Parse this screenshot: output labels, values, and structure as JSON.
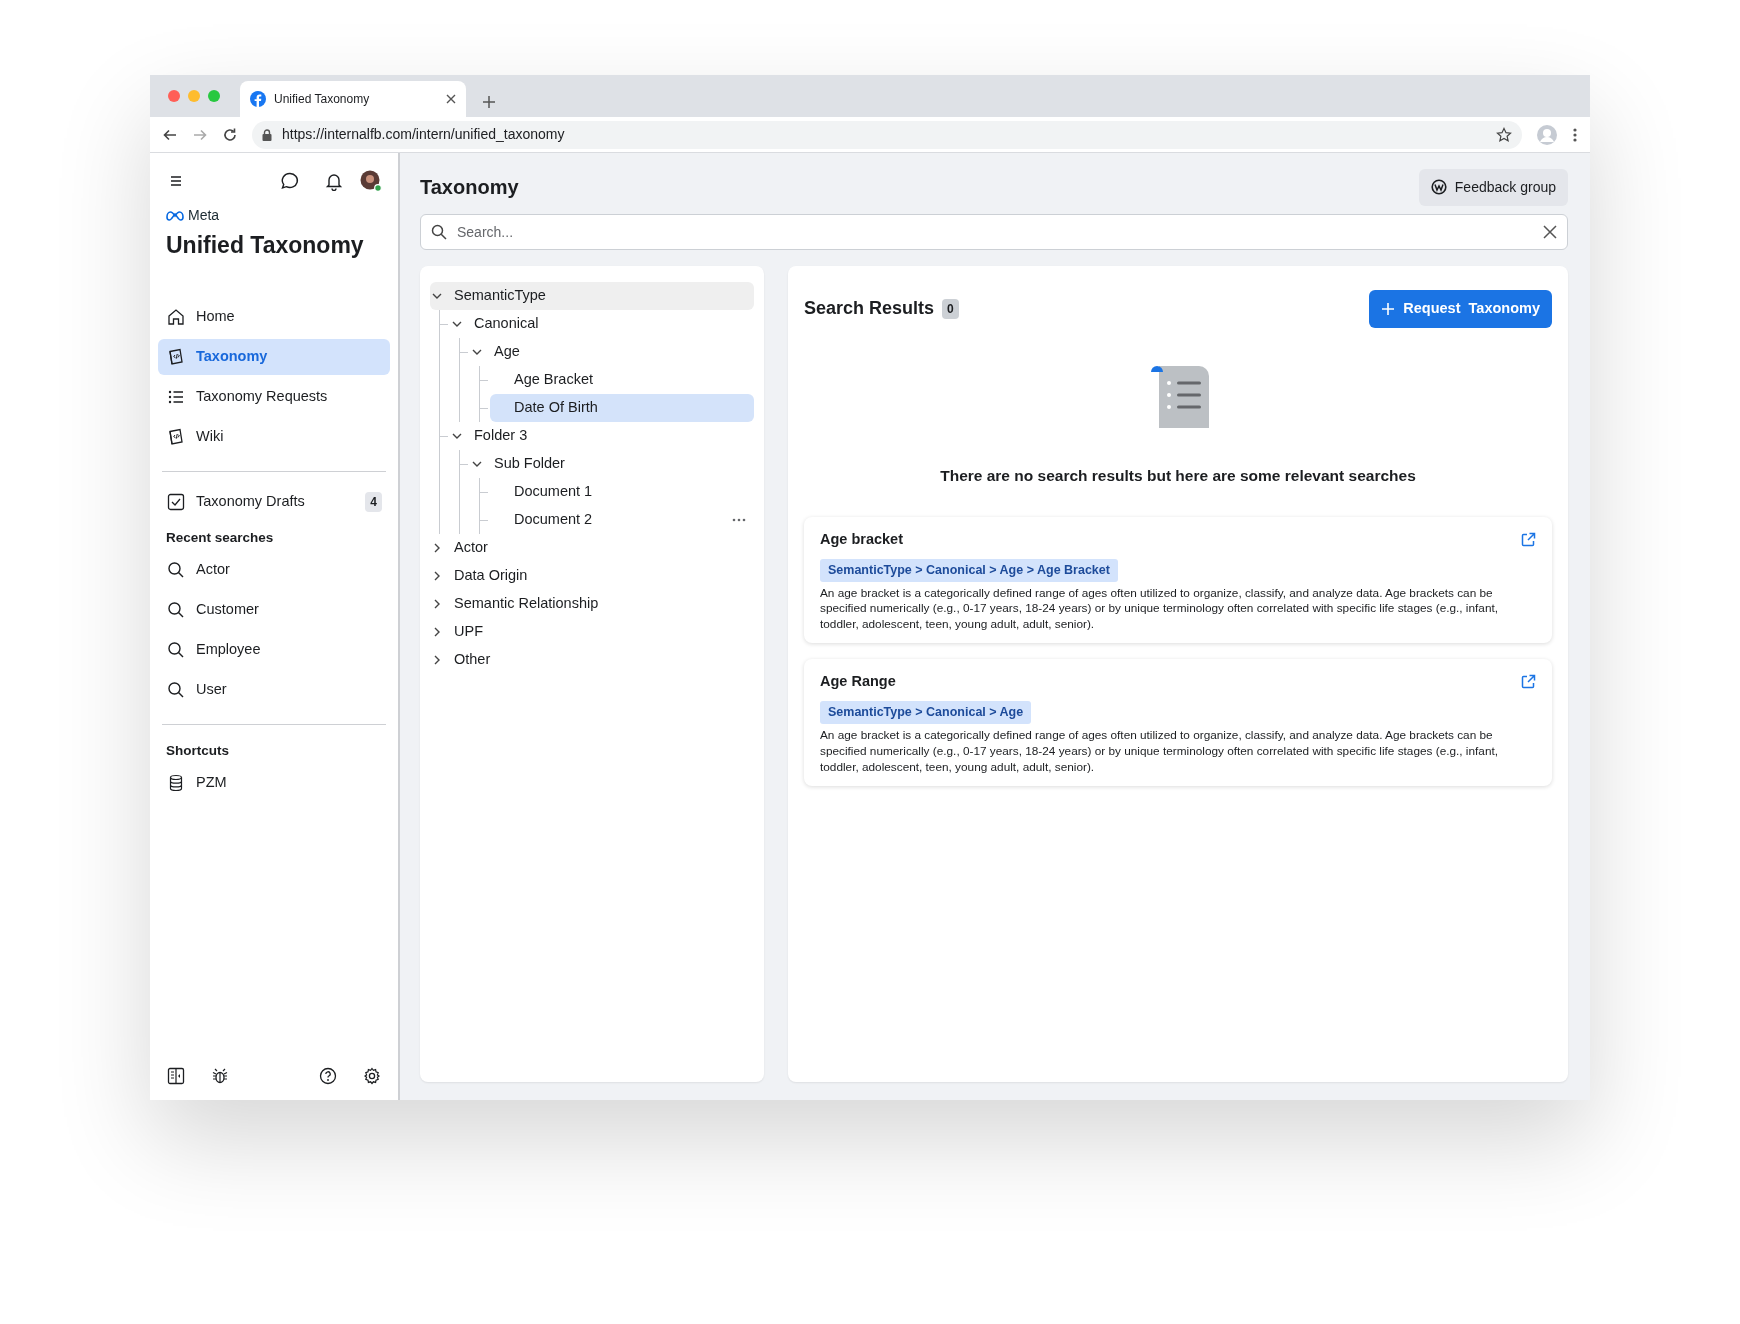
{
  "browser": {
    "tab_title": "Unified Taxonomy",
    "url": "https://internalfb.com/intern/unified_taxonomy"
  },
  "sidebar": {
    "brand": "Meta",
    "app_title": "Unified Taxonomy",
    "nav": [
      {
        "label": "Home",
        "kind": "home",
        "selected": false
      },
      {
        "label": "Taxonomy",
        "kind": "book",
        "selected": true
      },
      {
        "label": "Taxonomy Requests",
        "kind": "list",
        "selected": false
      },
      {
        "label": "Wiki",
        "kind": "book",
        "selected": false
      }
    ],
    "drafts": {
      "label": "Taxonomy Drafts",
      "count": "4"
    },
    "recent_heading": "Recent searches",
    "recent": [
      "Actor",
      "Customer",
      "Employee",
      "User"
    ],
    "shortcuts_heading": "Shortcuts",
    "shortcuts": [
      "PZM"
    ]
  },
  "header": {
    "title": "Taxonomy",
    "feedback_button": "Feedback group"
  },
  "search": {
    "placeholder": "Search..."
  },
  "tree": [
    {
      "label": "SemanticType",
      "expanded": true,
      "selected": false,
      "hovered": true,
      "children": [
        {
          "label": "Canonical",
          "expanded": true,
          "selected": false,
          "hovered": false,
          "children": [
            {
              "label": "Age",
              "expanded": true,
              "selected": false,
              "hovered": false,
              "children": [
                {
                  "label": "Age Bracket",
                  "selected": false,
                  "hovered": false
                },
                {
                  "label": "Date Of Birth",
                  "selected": true,
                  "hovered": false
                }
              ]
            }
          ]
        },
        {
          "label": "Folder 3",
          "expanded": true,
          "selected": false,
          "hovered": false,
          "children": [
            {
              "label": "Sub Folder",
              "expanded": true,
              "selected": false,
              "hovered": false,
              "children": [
                {
                  "label": "Document 1",
                  "selected": false,
                  "hovered": false
                },
                {
                  "label": "Document 2",
                  "selected": false,
                  "hovered": false,
                  "actions": true
                }
              ]
            }
          ]
        }
      ]
    },
    {
      "label": "Actor",
      "expanded": false,
      "selected": false,
      "hovered": false
    },
    {
      "label": "Data Origin",
      "expanded": false,
      "selected": false,
      "hovered": false
    },
    {
      "label": "Semantic Relationship",
      "expanded": false,
      "selected": false,
      "hovered": false
    },
    {
      "label": "UPF",
      "expanded": false,
      "selected": false,
      "hovered": false
    },
    {
      "label": "Other",
      "expanded": false,
      "selected": false,
      "hovered": false
    }
  ],
  "results": {
    "title": "Search Results",
    "count": "0",
    "request_button": "Request  Taxonomy",
    "empty_message": "There are no search results but here are some relevant searches",
    "cards": [
      {
        "title": "Age bracket",
        "path": "SemanticType > Canonical > Age > Age Bracket",
        "description": "An age bracket is a categorically defined range of ages often utilized to organize, classify, and analyze data. Age brackets can be specified numerically (e.g., 0-17 years, 18-24 years) or by unique terminology often correlated with specific life stages (e.g., infant, toddler, adolescent, teen, young adult, adult, senior)."
      },
      {
        "title": "Age Range",
        "path": "SemanticType > Canonical > Age",
        "description": "An age bracket is a categorically defined range of ages often utilized to organize, classify, and analyze data. Age brackets can be specified numerically (e.g., 0-17 years, 18-24 years) or by unique terminology often correlated with specific life stages (e.g., infant, toddler, adolescent, teen, young adult, adult, senior)."
      }
    ]
  }
}
